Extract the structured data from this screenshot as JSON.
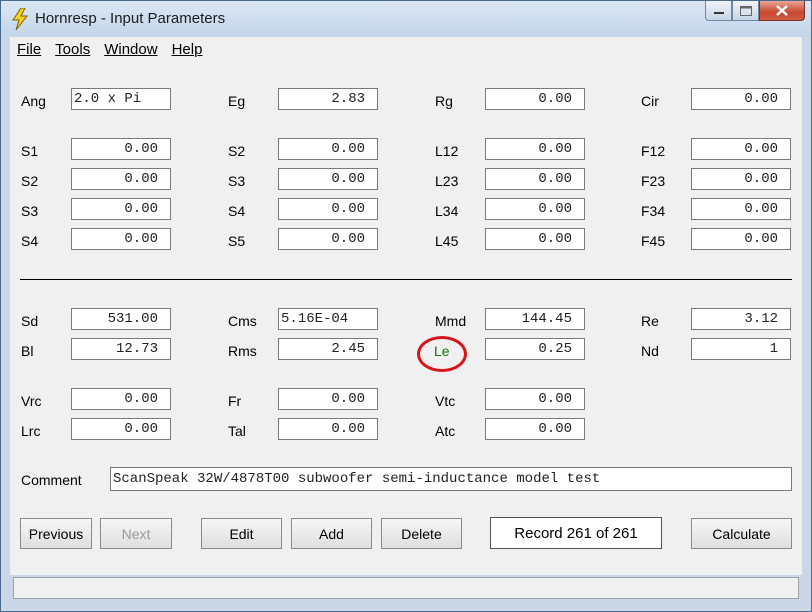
{
  "window": {
    "title": "Hornresp - Input Parameters"
  },
  "icons": {
    "app": "lightning-bolt-icon",
    "minimize": "minimize-icon",
    "maximize": "maximize-icon",
    "close": "close-icon"
  },
  "menu": {
    "file": "File",
    "tools": "Tools",
    "window": "Window",
    "help": "Help"
  },
  "top_params": {
    "ang": {
      "label": "Ang",
      "value": "2.0 x Pi"
    },
    "eg": {
      "label": "Eg",
      "value": "2.83"
    },
    "rg": {
      "label": "Rg",
      "value": "0.00"
    },
    "cir": {
      "label": "Cir",
      "value": "0.00"
    }
  },
  "col1": [
    {
      "label": "S1",
      "value": "0.00"
    },
    {
      "label": "S2",
      "value": "0.00"
    },
    {
      "label": "S3",
      "value": "0.00"
    },
    {
      "label": "S4",
      "value": "0.00"
    }
  ],
  "col2": [
    {
      "label": "S2",
      "value": "0.00"
    },
    {
      "label": "S3",
      "value": "0.00"
    },
    {
      "label": "S4",
      "value": "0.00"
    },
    {
      "label": "S5",
      "value": "0.00"
    }
  ],
  "col3": [
    {
      "label": "L12",
      "value": "0.00"
    },
    {
      "label": "L23",
      "value": "0.00"
    },
    {
      "label": "L34",
      "value": "0.00"
    },
    {
      "label": "L45",
      "value": "0.00"
    }
  ],
  "col4": [
    {
      "label": "F12",
      "value": "0.00"
    },
    {
      "label": "F23",
      "value": "0.00"
    },
    {
      "label": "F34",
      "value": "0.00"
    },
    {
      "label": "F45",
      "value": "0.00"
    }
  ],
  "driver": {
    "sd": {
      "label": "Sd",
      "value": "531.00"
    },
    "cms": {
      "label": "Cms",
      "value": "5.16E-04"
    },
    "mmd": {
      "label": "Mmd",
      "value": "144.45"
    },
    "re": {
      "label": "Re",
      "value": "3.12"
    },
    "bl": {
      "label": "Bl",
      "value": "12.73"
    },
    "rms": {
      "label": "Rms",
      "value": "2.45"
    },
    "le": {
      "label": "Le",
      "value": "0.25",
      "label_color": "#0a7a0a",
      "highlight_color": "#d8141c"
    },
    "nd": {
      "label": "Nd",
      "value": "1"
    }
  },
  "extra": {
    "vrc": {
      "label": "Vrc",
      "value": "0.00"
    },
    "fr": {
      "label": "Fr",
      "value": "0.00"
    },
    "vtc": {
      "label": "Vtc",
      "value": "0.00"
    },
    "lrc": {
      "label": "Lrc",
      "value": "0.00"
    },
    "tal": {
      "label": "Tal",
      "value": "0.00"
    },
    "atc": {
      "label": "Atc",
      "value": "0.00"
    }
  },
  "comment": {
    "label": "Comment",
    "value": "ScanSpeak 32W/4878T00 subwoofer semi-inductance model test"
  },
  "buttons": {
    "previous": "Previous",
    "next": "Next",
    "edit": "Edit",
    "add": "Add",
    "delete": "Delete",
    "calculate": "Calculate"
  },
  "record": {
    "text": "Record 261 of 261"
  }
}
